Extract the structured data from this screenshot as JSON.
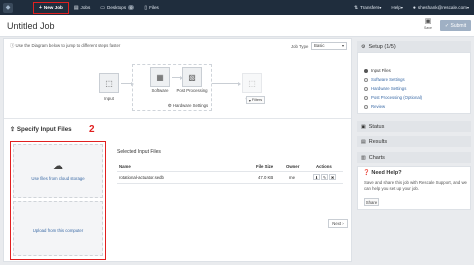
{
  "nav": {
    "new_job": "New Job",
    "jobs": "Jobs",
    "desktops": "Desktops",
    "desktops_badge": "0",
    "files": "Files",
    "transfers": "Transfers",
    "help": "Help",
    "user": "sheshank@rescale.com"
  },
  "annotations": {
    "one": "1",
    "two": "2"
  },
  "header": {
    "title": "Untitled Job",
    "save_label": "Save",
    "submit_label": "Submit"
  },
  "main": {
    "hint": "Use the Diagram below to jump to different steps faster",
    "job_type_label": "Job Type",
    "job_type_value": "Basic",
    "diagram": {
      "input": "Input",
      "software": "Software",
      "post_processing": "Post Processing",
      "hardware_settings": "Hardware Settings",
      "output": "Output",
      "filters": "Filters"
    },
    "spec_title": "Specify Input Files",
    "upload_cloud": "Use files from cloud storage",
    "upload_computer": "Upload from this computer",
    "selected_title": "Selected Input Files",
    "columns": {
      "name": "Name",
      "size": "File Size",
      "owner": "Owner",
      "actions": "Actions"
    },
    "row": {
      "name": "rotational-actuator.sedb",
      "size": "47.0 KB",
      "owner": "me"
    },
    "next": "Next ›"
  },
  "sidebar": {
    "setup_title": "Setup (1/5)",
    "steps": [
      "Input Files",
      "Software Settings",
      "Hardware Settings",
      "Post Processing (Optional)",
      "Review"
    ],
    "status": "Status",
    "results": "Results",
    "charts": "Charts",
    "help_title": "Need Help?",
    "help_text": "Save and share this job with Rescale Support, and we can help you set up your job.",
    "help_button": "Share"
  },
  "colors": {
    "nav_bg": "#1f2d3d",
    "highlight": "#e02020",
    "link": "#3a6aa6",
    "submit_bg": "#9fb0c4"
  }
}
